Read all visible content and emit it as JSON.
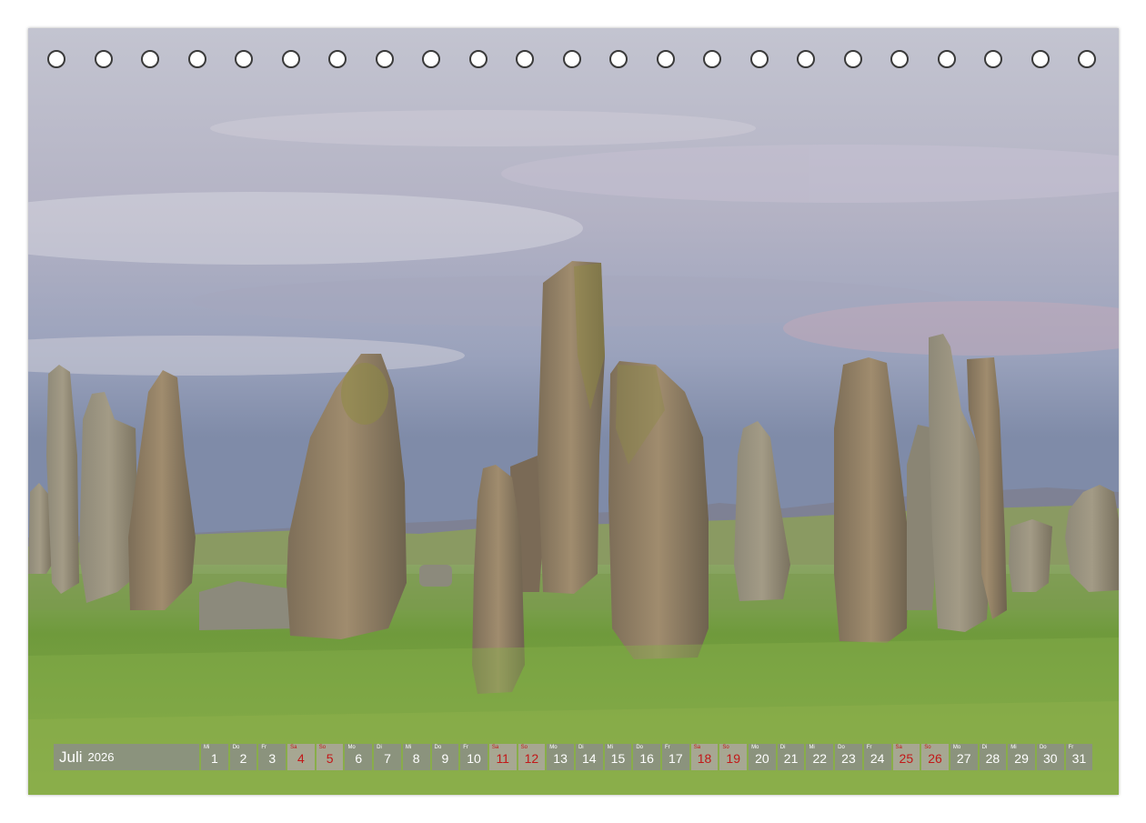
{
  "calendar": {
    "month": "Juli",
    "year": "2026",
    "days": [
      {
        "n": "1",
        "wd": "Mi",
        "red": false
      },
      {
        "n": "2",
        "wd": "Do",
        "red": false
      },
      {
        "n": "3",
        "wd": "Fr",
        "red": false
      },
      {
        "n": "4",
        "wd": "Sa",
        "red": true
      },
      {
        "n": "5",
        "wd": "So",
        "red": true
      },
      {
        "n": "6",
        "wd": "Mo",
        "red": false
      },
      {
        "n": "7",
        "wd": "Di",
        "red": false
      },
      {
        "n": "8",
        "wd": "Mi",
        "red": false
      },
      {
        "n": "9",
        "wd": "Do",
        "red": false
      },
      {
        "n": "10",
        "wd": "Fr",
        "red": false
      },
      {
        "n": "11",
        "wd": "Sa",
        "red": true
      },
      {
        "n": "12",
        "wd": "So",
        "red": true
      },
      {
        "n": "13",
        "wd": "Mo",
        "red": false
      },
      {
        "n": "14",
        "wd": "Di",
        "red": false
      },
      {
        "n": "15",
        "wd": "Mi",
        "red": false
      },
      {
        "n": "16",
        "wd": "Do",
        "red": false
      },
      {
        "n": "17",
        "wd": "Fr",
        "red": false
      },
      {
        "n": "18",
        "wd": "Sa",
        "red": true
      },
      {
        "n": "19",
        "wd": "So",
        "red": true
      },
      {
        "n": "20",
        "wd": "Mo",
        "red": false
      },
      {
        "n": "21",
        "wd": "Di",
        "red": false
      },
      {
        "n": "22",
        "wd": "Mi",
        "red": false
      },
      {
        "n": "23",
        "wd": "Do",
        "red": false
      },
      {
        "n": "24",
        "wd": "Fr",
        "red": false
      },
      {
        "n": "25",
        "wd": "Sa",
        "red": true
      },
      {
        "n": "26",
        "wd": "So",
        "red": true
      },
      {
        "n": "27",
        "wd": "Mo",
        "red": false
      },
      {
        "n": "28",
        "wd": "Di",
        "red": false
      },
      {
        "n": "29",
        "wd": "Mi",
        "red": false
      },
      {
        "n": "30",
        "wd": "Do",
        "red": false
      },
      {
        "n": "31",
        "wd": "Fr",
        "red": false
      }
    ]
  },
  "colors": {
    "sky_top": "#b9bccb",
    "sky_bottom": "#7f8aa8",
    "grass": "#6f9a3c",
    "stone": "#8a7a60",
    "weekend_text": "#c21818"
  }
}
